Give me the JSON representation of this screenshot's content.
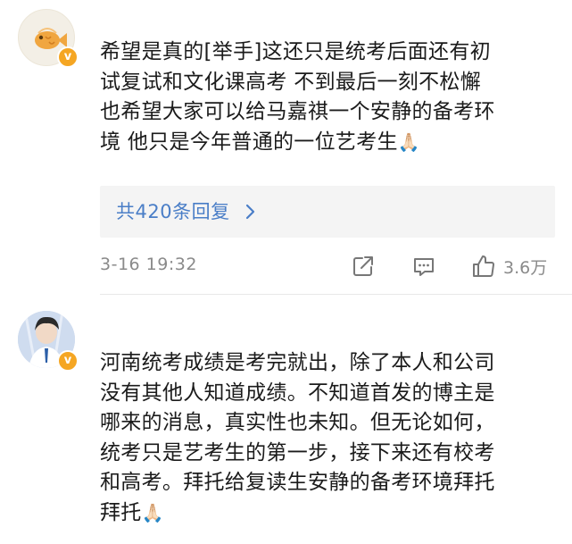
{
  "comments": [
    {
      "text": "希望是真的[举手]这还只是统考后面还有初\n试复试和文化课高考 不到最后一刻不松懈\n也希望大家可以给马嘉祺一个安静的备考环\n境 他只是今年普通的一位艺考生",
      "emoji": "🙏🏻",
      "reply_link": "共420条回复",
      "date": "3-16 19:32",
      "like_count": "3.6万",
      "avatar_icon": "taiyaki-avatar",
      "badge_icon": "verified-v-badge"
    },
    {
      "text": "河南统考成绩是考完就出，除了本人和公司\n没有其他人知道成绩。不知道首发的博主是\n哪来的消息，真实性也未知。但无论如何，\n统考只是艺考生的第一步，接下来还有校考\n和高考。拜托给复读生安静的备考环境拜托\n拜托",
      "emoji": "🙏🏻",
      "avatar_icon": "person-avatar",
      "badge_icon": "verified-v-badge"
    }
  ],
  "colors": {
    "link": "#4a7ec7",
    "meta": "#8a8a8a",
    "badge": "#f5a623"
  }
}
